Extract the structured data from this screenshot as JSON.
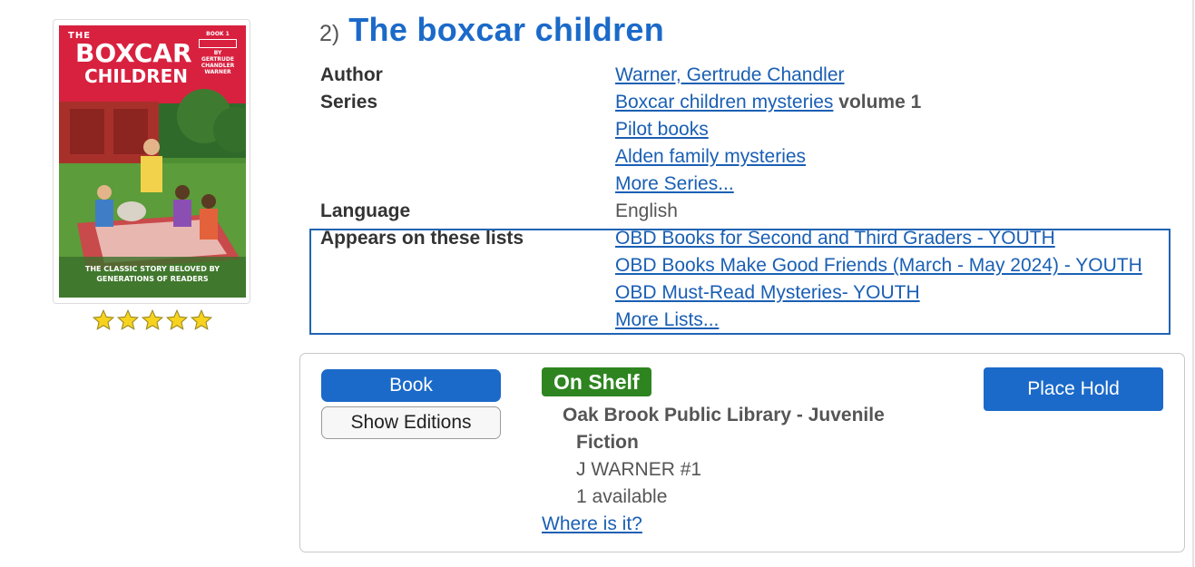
{
  "record": {
    "result_number": "2)",
    "title": "The boxcar children"
  },
  "cover": {
    "alt_title_top": "THE",
    "alt_title_main1": "BOXCAR",
    "alt_title_main2": "CHILDREN",
    "book_badge": "BOOK",
    "book_badge_num": "1",
    "by_line": "BY",
    "author_line1": "GERTRUDE",
    "author_line2": "CHANDLER",
    "author_line3": "WARNER",
    "tagline1": "THE CLASSIC STORY BELOVED BY",
    "tagline2": "GENERATIONS OF READERS",
    "colors": {
      "banner": "#d8213f",
      "grass": "#4f8f34"
    }
  },
  "rating": {
    "stars": 5,
    "max": 5,
    "color": "#f7d31e"
  },
  "details": {
    "author_label": "Author",
    "author_value": "Warner, Gertrude Chandler",
    "series_label": "Series",
    "series": [
      {
        "name": "Boxcar children mysteries",
        "suffix": "volume 1"
      },
      {
        "name": "Pilot books",
        "suffix": ""
      },
      {
        "name": "Alden family mysteries",
        "suffix": ""
      }
    ],
    "more_series": "More Series...",
    "language_label": "Language",
    "language_value": "English",
    "lists_label": "Appears on these lists",
    "lists": [
      "OBD Books for Second and Third Graders - YOUTH",
      "OBD Books Make Good Friends (March - May 2024) - YOUTH",
      "OBD Must-Read Mysteries- YOUTH"
    ],
    "more_lists": "More Lists..."
  },
  "copies": {
    "format_button": "Book",
    "show_editions_button": "Show Editions",
    "status": "On Shelf",
    "location_line1": "Oak Brook Public Library - Juvenile",
    "location_line2": "Fiction",
    "call_number": "J WARNER #1",
    "available": "1 available",
    "where_link": "Where is it?",
    "place_hold_button": "Place Hold",
    "colors": {
      "primary": "#1b6ac9",
      "status_green": "#2e8520",
      "link": "#1a5fb4"
    }
  }
}
